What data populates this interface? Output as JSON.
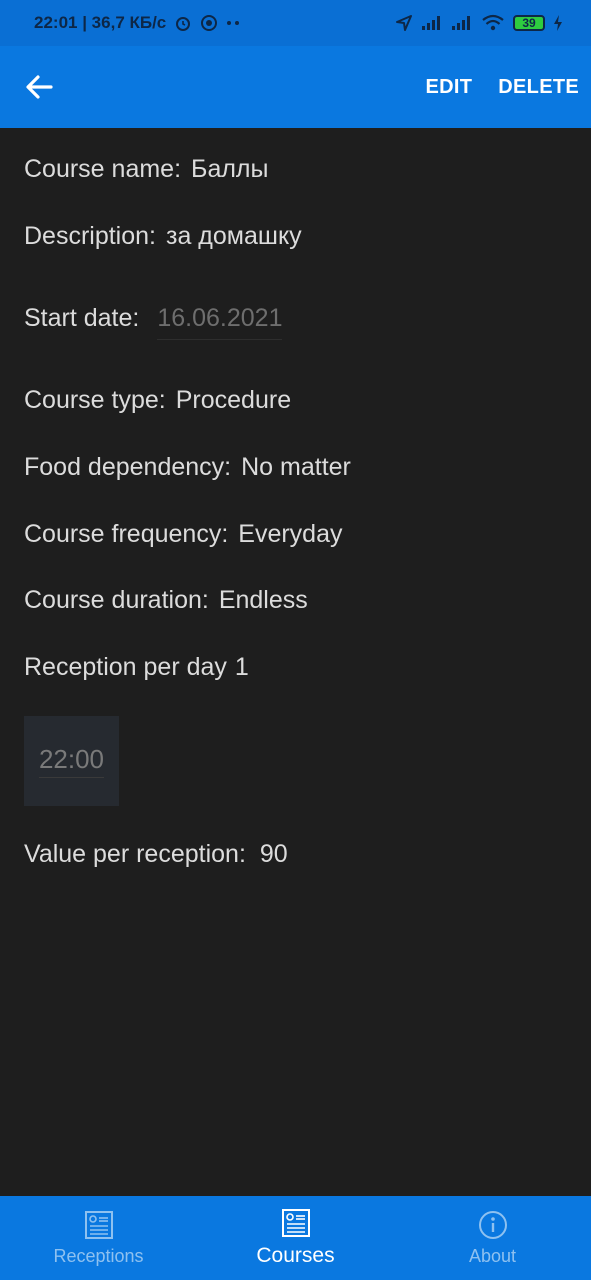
{
  "status_bar": {
    "time_speed": "22:01 | 36,7 КБ/с",
    "battery": "39"
  },
  "app_bar": {
    "edit_label": "EDIT",
    "delete_label": "DELETE"
  },
  "details": {
    "course_name_label": "Course name:",
    "course_name_value": "Баллы",
    "description_label": "Description:",
    "description_value": "за домашку",
    "start_date_label": "Start date:",
    "start_date_value": "16.06.2021",
    "course_type_label": "Course type:",
    "course_type_value": "Procedure",
    "food_dependency_label": "Food dependency:",
    "food_dependency_value": "No matter",
    "course_frequency_label": "Course frequency:",
    "course_frequency_value": "Everyday",
    "course_duration_label": "Course duration:",
    "course_duration_value": "Endless",
    "reception_per_day_label": "Reception per day",
    "reception_per_day_value": "1",
    "reception_time": "22:00",
    "value_per_reception_label": "Value per reception:",
    "value_per_reception_value": "90"
  },
  "bottom_nav": {
    "items": [
      {
        "label": "Receptions",
        "icon": "receptions-icon",
        "active": false
      },
      {
        "label": "Courses",
        "icon": "courses-icon",
        "active": true
      },
      {
        "label": "About",
        "icon": "info-icon",
        "active": false
      }
    ]
  },
  "colors": {
    "primary": "#0a78e0",
    "background": "#1e1e1e",
    "text": "#dcdcdc"
  }
}
